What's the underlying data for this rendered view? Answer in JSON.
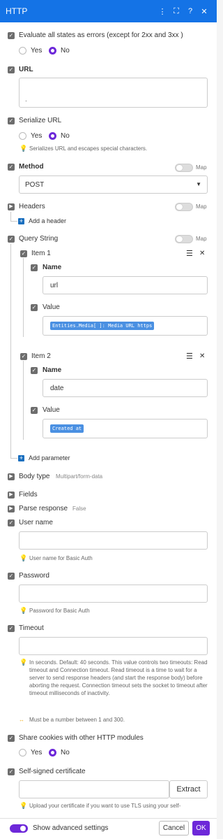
{
  "header": {
    "title": "HTTP",
    "icons": [
      "more-icon",
      "expand-icon",
      "help-icon",
      "close-icon"
    ]
  },
  "evaluate": {
    "label": "Evaluate all states as errors (except for 2xx and 3xx )",
    "yes": "Yes",
    "no": "No",
    "selected": "No"
  },
  "url": {
    "label": "URL",
    "value": "."
  },
  "serialize": {
    "label": "Serialize URL",
    "yes": "Yes",
    "no": "No",
    "selected": "No",
    "hint": "Serializes URL and escapes special characters."
  },
  "method": {
    "label": "Method",
    "map": "Map",
    "value": "POST"
  },
  "headers": {
    "label": "Headers",
    "map": "Map",
    "add": "Add a header"
  },
  "query": {
    "label": "Query String",
    "map": "Map",
    "items": [
      {
        "label": "Item 1",
        "name_label": "Name",
        "name_value": "url",
        "value_label": "Value",
        "tokens": [
          "Entities.Media[ ]: Media URL https"
        ]
      },
      {
        "label": "Item 2",
        "name_label": "Name",
        "name_value": "date",
        "value_label": "Value",
        "tokens": [
          "Created at"
        ]
      }
    ],
    "add": "Add parameter"
  },
  "body_type": {
    "label": "Body type",
    "value": "Multipart/form-data"
  },
  "fields": {
    "label": "Fields"
  },
  "parse": {
    "label": "Parse response",
    "value": "False"
  },
  "username": {
    "label": "User name",
    "hint": "User name for Basic Auth"
  },
  "password": {
    "label": "Password",
    "hint": "Password for Basic Auth"
  },
  "timeout": {
    "label": "Timeout",
    "help": "In seconds. Default: 40 seconds. This value controls two timeouts: Read timeout and Connection timeout. Read timeout is a time to wait for a server to send response headers (and start the response body) before aborting the request. Connection timeout sets the socket to timeout after timeout milliseconds of inactivity.",
    "range": "Must be a number between 1 and 300."
  },
  "cookies": {
    "label": "Share cookies with other HTTP modules",
    "yes": "Yes",
    "no": "No",
    "selected": "No"
  },
  "cert": {
    "label": "Self-signed certificate",
    "extract": "Extract",
    "hint": "Upload your certificate if you want to use TLS using your self-"
  },
  "footer": {
    "advanced": "Show advanced settings",
    "cancel": "Cancel",
    "ok": "OK"
  },
  "colors": {
    "header": "#1473e6",
    "accent": "#6d28d9",
    "pill": "#4a90e2"
  }
}
